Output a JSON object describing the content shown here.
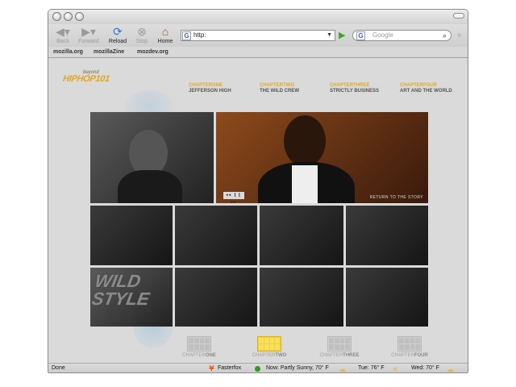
{
  "toolbar": {
    "back_label": "Back",
    "forward_label": "Forward",
    "reload_label": "Reload",
    "stop_label": "Stop",
    "home_label": "Home"
  },
  "url_bar": {
    "value": "http:"
  },
  "search_bar": {
    "placeholder": "Google"
  },
  "bookmarks": [
    "mozilla.org",
    "mozillaZine",
    "mozdev.org"
  ],
  "site": {
    "logo": "HIPHOP101",
    "logo_sub": "beyond",
    "chapters": [
      {
        "prefix": "CHAPTER",
        "num": "ONE",
        "title": "JEFFERSON HIGH"
      },
      {
        "prefix": "CHAPTER",
        "num": "TWO",
        "title": "THE WILD CREW"
      },
      {
        "prefix": "CHAPTER",
        "num": "THREE",
        "title": "STRICTLY BUSINESS"
      },
      {
        "prefix": "CHAPTER",
        "num": "FOUR",
        "title": "ART AND THE WORLD"
      }
    ],
    "player_controls": "◂◂ ❙❙ ▸▸",
    "return_label": "RETURN TO THE STORY",
    "graffiti_text": "WILD STYLE",
    "active_chapter": 2
  },
  "status": {
    "text": "Done",
    "fasterfox": "Fasterfox",
    "weather_now": "Now: Partly Sunny, 70° F",
    "weather_tue": "Tue: 76° F",
    "weather_wed": "Wed: 70° F"
  },
  "colors": {
    "accent": "#e0a820",
    "active_grid": "#f1d13a"
  }
}
